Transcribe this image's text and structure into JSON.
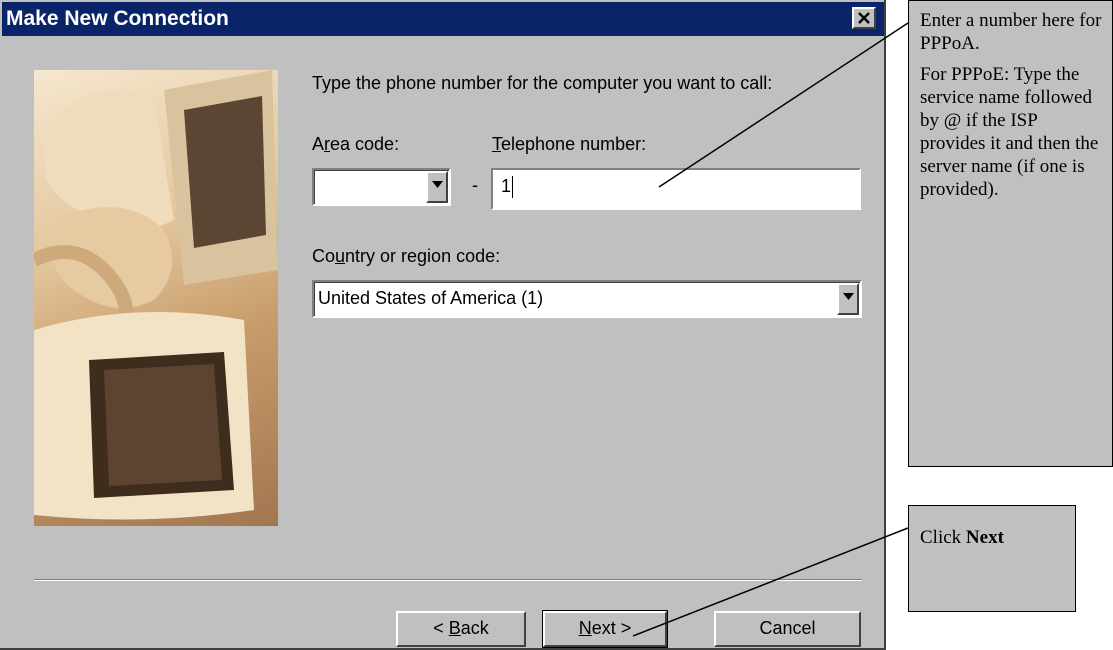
{
  "dialog": {
    "title": "Make New Connection",
    "close_icon": "close-icon",
    "instruction": "Type the phone number for the computer you want to call:",
    "area_code": {
      "label_pre": "A",
      "label_ul": "r",
      "label_post": "ea code:",
      "value": ""
    },
    "dash": "-",
    "telephone": {
      "label_ul": "T",
      "label_post": "elephone number:",
      "value": "1"
    },
    "country": {
      "label_pre": "Co",
      "label_ul": "u",
      "label_post": "ntry or region code:",
      "selected": "United States of America (1)"
    },
    "buttons": {
      "back": {
        "pre": "< ",
        "ul": "B",
        "post": "ack"
      },
      "next": {
        "ul": "N",
        "post": "ext >"
      },
      "cancel": "Cancel"
    }
  },
  "callouts": {
    "phone_note": {
      "line1": "Enter a number here for PPPoA.",
      "line2": "For PPPoE: Type the service name followed by @ if the ISP provides it and then the server name (if one is provided)."
    },
    "next_note": {
      "pre": "Click ",
      "bold": "Next"
    }
  },
  "colors": {
    "dialog_bg": "#c0c0c0",
    "titlebar": "#0a246a",
    "callout_bg": "#c0c0c0"
  }
}
